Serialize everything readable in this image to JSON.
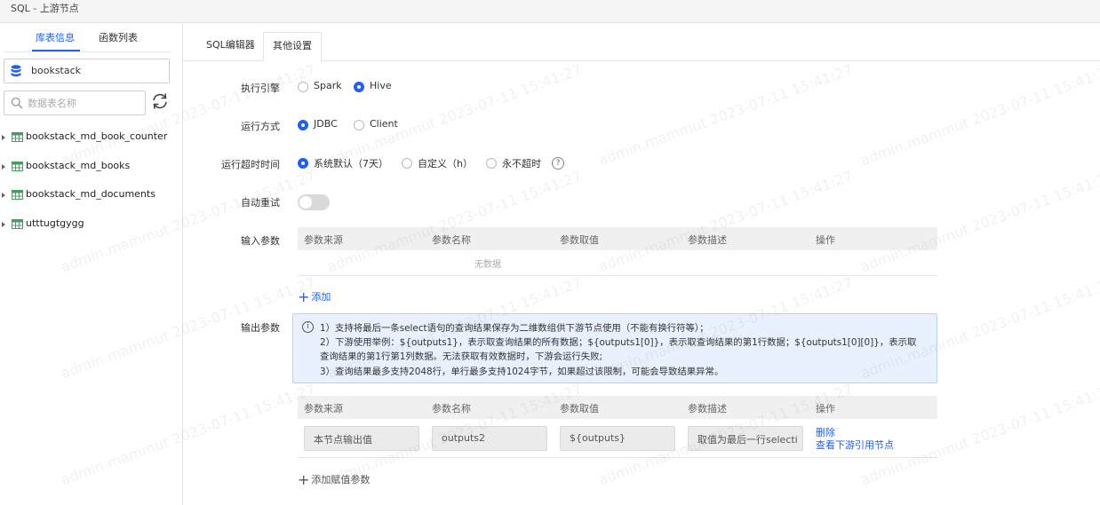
{
  "window": {
    "title": "SQL - 上游节点"
  },
  "sidebar": {
    "tabs": [
      {
        "label": "库表信息",
        "active": true
      },
      {
        "label": "函数列表",
        "active": false
      }
    ],
    "database": {
      "value": "bookstack",
      "icon": "database-icon"
    },
    "search": {
      "placeholder": "数据表名称"
    },
    "tables": [
      {
        "name": "bookstack_md_book_counter"
      },
      {
        "name": "bookstack_md_books"
      },
      {
        "name": "bookstack_md_documents"
      },
      {
        "name": "utttugtgygg"
      }
    ]
  },
  "main": {
    "tabs": [
      {
        "label": "SQL编辑器",
        "active": false
      },
      {
        "label": "其他设置",
        "active": true
      }
    ],
    "engine": {
      "label": "执行引擎",
      "options": [
        {
          "label": "Spark",
          "checked": false
        },
        {
          "label": "Hive",
          "checked": true
        }
      ]
    },
    "run_mode": {
      "label": "运行方式",
      "options": [
        {
          "label": "JDBC",
          "checked": true
        },
        {
          "label": "Client",
          "checked": false
        }
      ]
    },
    "timeout": {
      "label": "运行超时时间",
      "options": [
        {
          "label": "系统默认（7天）",
          "checked": true
        },
        {
          "label": "自定义（h）",
          "checked": false
        },
        {
          "label": "永不超时",
          "checked": false
        }
      ],
      "help": "?"
    },
    "auto_retry": {
      "label": "自动重试",
      "enabled": false
    },
    "input_params": {
      "label": "输入参数",
      "columns": [
        "参数来源",
        "参数名称",
        "参数取值",
        "参数描述",
        "操作"
      ],
      "empty_text": "无数据",
      "add_label": "添加"
    },
    "output_params": {
      "label": "输出参数",
      "notice_icon": "i",
      "notice_lines": [
        "1）支持将最后一条select语句的查询结果保存为二维数组供下游节点使用（不能有换行符等）；",
        "2）下游使用举例：${outputs1}，表示取查询结果的所有数据；${outputs1[0]}，表示取查询结果的第1行数据；${outputs1[0][0]}，表示取",
        "查询结果的第1行第1列数据。无法获取有效数据时，下游会运行失败;",
        "3）查询结果最多支持2048行，单行最多支持1024字节，如果超过该限制，可能会导致结果异常。"
      ],
      "columns": [
        "参数来源",
        "参数名称",
        "参数取值",
        "参数描述",
        "操作"
      ],
      "rows": [
        {
          "source": "本节点输出值",
          "name": "outputs2",
          "value": "${outputs}",
          "description": "取值为最后一行selecti",
          "actions": [
            "删除",
            "查看下游引用节点"
          ]
        }
      ],
      "add_label": "添加赋值参数"
    }
  },
  "watermark": {
    "text": "admin.mammut 2023-07-11 15:41:27"
  },
  "colors": {
    "accent": "#1e5eff",
    "notice_bg": "#e8f1fd"
  }
}
